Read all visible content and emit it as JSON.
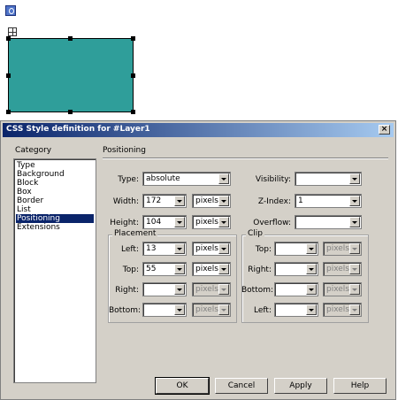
{
  "dialog": {
    "title": "CSS Style definition for #Layer1",
    "close_glyph": "×"
  },
  "category": {
    "header": "Category",
    "items": [
      "Type",
      "Background",
      "Block",
      "Box",
      "Border",
      "List",
      "Positioning",
      "Extensions"
    ],
    "selected": "Positioning"
  },
  "panel": {
    "header": "Positioning"
  },
  "fields": {
    "type": {
      "label": "Type:",
      "value": "absolute"
    },
    "width": {
      "label": "Width:",
      "value": "172",
      "unit": "pixels"
    },
    "height": {
      "label": "Height:",
      "value": "104",
      "unit": "pixels"
    },
    "visibility": {
      "label": "Visibility:",
      "value": ""
    },
    "zindex": {
      "label": "Z-Index:",
      "value": "1"
    },
    "overflow": {
      "label": "Overflow:",
      "value": ""
    }
  },
  "placement": {
    "legend": "Placement",
    "left": {
      "label": "Left:",
      "value": "13",
      "unit": "pixels"
    },
    "top": {
      "label": "Top:",
      "value": "55",
      "unit": "pixels"
    },
    "right": {
      "label": "Right:",
      "value": "",
      "unit": "pixels"
    },
    "bottom": {
      "label": "Bottom:",
      "value": "",
      "unit": "pixels"
    }
  },
  "clip": {
    "legend": "Clip",
    "top": {
      "label": "Top:",
      "value": "",
      "unit": "pixels"
    },
    "right": {
      "label": "Right:",
      "value": "",
      "unit": "pixels"
    },
    "bottom": {
      "label": "Bottom:",
      "value": "",
      "unit": "pixels"
    },
    "left": {
      "label": "Left:",
      "value": "",
      "unit": "pixels"
    }
  },
  "buttons": {
    "ok": "OK",
    "cancel": "Cancel",
    "apply": "Apply",
    "help": "Help"
  },
  "colors": {
    "layer_fill": "#2f9e9a",
    "title_start": "#0a246a",
    "title_end": "#a6caf0",
    "dialog_bg": "#d4d0c8"
  }
}
